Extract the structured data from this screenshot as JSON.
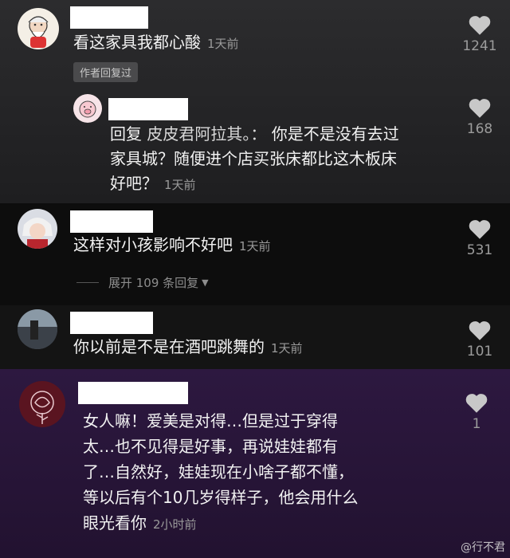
{
  "comments": [
    {
      "text": "看这家具我都心酸",
      "time": "1天前",
      "likes": "1241",
      "author_tag": "作者回复过"
    },
    {
      "reply_prefix": "回复",
      "reply_to": "皮皮君阿拉其。：",
      "lines": [
        "你是不是没有去过",
        "家具城？随便进个店买张床都比这木板床",
        "好吧？"
      ],
      "time": "1天前",
      "likes": "168"
    },
    {
      "text": "这样对小孩影响不好吧",
      "time": "1天前",
      "likes": "531",
      "expand_label": "展开 109 条回复"
    },
    {
      "text": "你以前是不是在酒吧跳舞的",
      "time": "1天前",
      "likes": "101"
    },
    {
      "lines": [
        "女人嘛！爱美是对得…但是过于穿得",
        "太…也不见得是好事，再说娃娃都有",
        "了…自然好，娃娃现在小啥子都不懂，",
        "等以后有个10几岁得样子，他会用什么",
        "眼光看你"
      ],
      "time": "2小时前",
      "likes": "1"
    }
  ],
  "watermark": "@行不君",
  "colors": {
    "like_icon": "#c8c8c8",
    "muted_text": "#9a9a9a"
  },
  "icons": {
    "like": "heart-icon",
    "expand_arrow": "triangle-down-icon"
  }
}
